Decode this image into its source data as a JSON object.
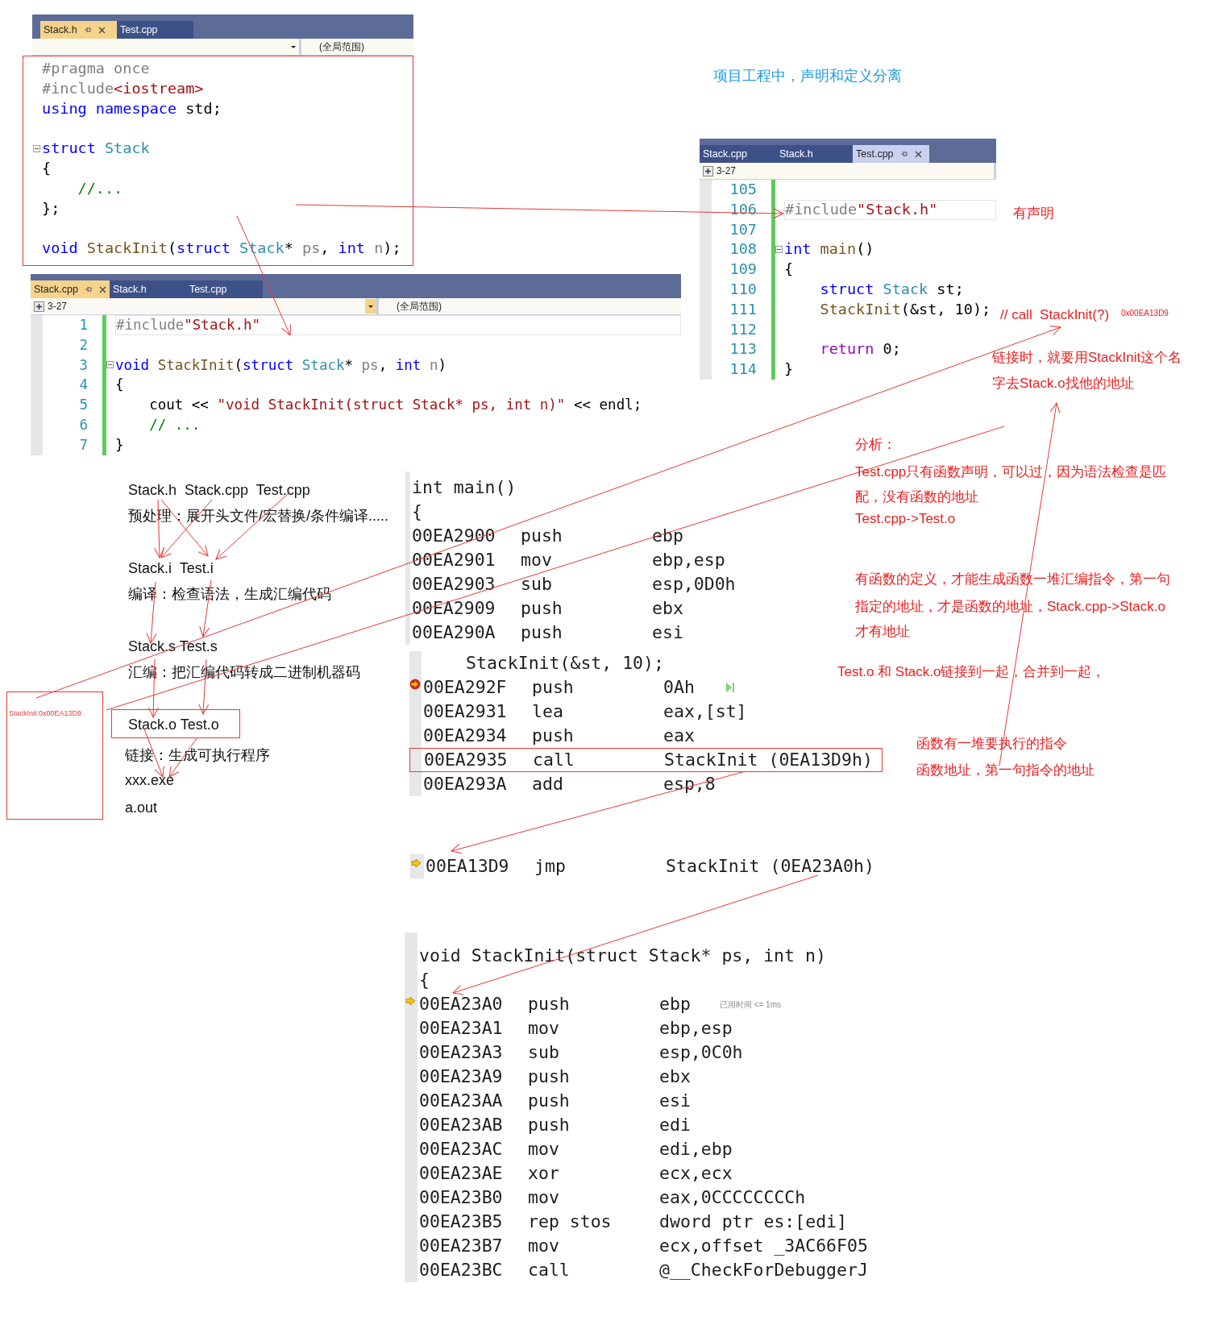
{
  "notes": [
    {
      "text": "项目工程中，声明和定义分离",
      "kind": "heading"
    },
    {
      "text": "有声明",
      "kind": "note"
    },
    {
      "text": "// call  StackInit(?)",
      "kind": "note"
    },
    {
      "text": "0x00EA13D9",
      "kind": "tiny"
    },
    {
      "text": "链接时，就要用StackInit这个名",
      "kind": "note"
    },
    {
      "text": "字去Stack.o找他的地址",
      "kind": "note"
    },
    {
      "text": "分析：",
      "kind": "note"
    },
    {
      "text": "Test.cpp只有函数声明，可以过，因为语法检查是匹",
      "kind": "note"
    },
    {
      "text": "配，没有函数的地址",
      "kind": "note"
    },
    {
      "text": "Test.cpp->Test.o",
      "kind": "note"
    },
    {
      "text": "有函数的定义，才能生成函数一堆汇编指令，第一句",
      "kind": "note"
    },
    {
      "text": "指定的地址，才是函数的地址，Stack.cpp->Stack.o",
      "kind": "note"
    },
    {
      "text": "才有地址",
      "kind": "note"
    },
    {
      "text": "Test.o 和 Stack.o链接到一起，合并到一起，",
      "kind": "note"
    },
    {
      "text": "函数有一堆要执行的指令",
      "kind": "note"
    },
    {
      "text": "函数地址，第一句指令的地址",
      "kind": "note"
    }
  ],
  "editors": [
    {
      "focused": true,
      "outlined": true,
      "tabs": [
        {
          "label": "Stack.h",
          "selected": true
        },
        {
          "label": "Test.cpp",
          "selected": false
        }
      ],
      "toolbar": {
        "scope": "(全局范围)"
      },
      "lines": [
        {
          "fold": false,
          "tokens": [
            {
              "text": "#pragma once",
              "kind": "pre"
            }
          ]
        },
        {
          "fold": false,
          "tokens": [
            {
              "text": "#include",
              "kind": "pre"
            },
            {
              "text": "<iostream>",
              "kind": "str"
            }
          ]
        },
        {
          "fold": false,
          "tokens": [
            {
              "text": "using namespace",
              "kind": "kw"
            },
            {
              "text": " std;",
              "kind": "plain"
            }
          ]
        },
        {
          "fold": false
        },
        {
          "fold": true,
          "tokens": [
            {
              "text": "struct",
              "kind": "kw"
            },
            {
              "text": " Stack",
              "kind": "type"
            }
          ]
        },
        {
          "fold": false,
          "tokens": [
            {
              "text": "{",
              "kind": "plain"
            }
          ]
        },
        {
          "fold": false,
          "tokens": [
            {
              "text": "    //...",
              "kind": "com"
            }
          ]
        },
        {
          "fold": false,
          "tokens": [
            {
              "text": "};",
              "kind": "plain"
            }
          ]
        },
        {
          "fold": false
        },
        {
          "fold": false,
          "tokens": [
            {
              "text": "void",
              "kind": "kw"
            },
            {
              "text": " StackInit",
              "kind": "func"
            },
            {
              "text": "(",
              "kind": "plain"
            },
            {
              "text": "struct",
              "kind": "kw"
            },
            {
              "text": " Stack",
              "kind": "type"
            },
            {
              "text": "* ",
              "kind": "plain"
            },
            {
              "text": "ps",
              "kind": "param"
            },
            {
              "text": ", ",
              "kind": "plain"
            },
            {
              "text": "int",
              "kind": "kw"
            },
            {
              "text": " n",
              "kind": "param"
            },
            {
              "text": ");",
              "kind": "plain"
            }
          ]
        }
      ]
    },
    {
      "focused": true,
      "outlined": false,
      "tabs": [
        {
          "label": "Stack.cpp",
          "selected": true
        },
        {
          "label": "Stack.h",
          "selected": false
        },
        {
          "label": "Test.cpp",
          "selected": false
        }
      ],
      "toolbar": {
        "project": "3-27",
        "scope": "(全局范围)"
      },
      "lines": [
        {
          "number": "1",
          "fold": false,
          "current": true,
          "tokens": [
            {
              "text": "#include",
              "kind": "pre"
            },
            {
              "text": "\"Stack.h\"",
              "kind": "str"
            }
          ]
        },
        {
          "number": "2",
          "fold": false,
          "current": false
        },
        {
          "number": "3",
          "fold": true,
          "current": false,
          "tokens": [
            {
              "text": "void",
              "kind": "kw"
            },
            {
              "text": " StackInit",
              "kind": "func"
            },
            {
              "text": "(",
              "kind": "plain"
            },
            {
              "text": "struct",
              "kind": "kw"
            },
            {
              "text": " Stack",
              "kind": "type"
            },
            {
              "text": "* ",
              "kind": "plain"
            },
            {
              "text": "ps",
              "kind": "param"
            },
            {
              "text": ", ",
              "kind": "plain"
            },
            {
              "text": "int",
              "kind": "kw"
            },
            {
              "text": " n",
              "kind": "param"
            },
            {
              "text": ")",
              "kind": "plain"
            }
          ]
        },
        {
          "number": "4",
          "fold": false,
          "current": false,
          "tokens": [
            {
              "text": "{",
              "kind": "plain"
            }
          ]
        },
        {
          "number": "5",
          "fold": false,
          "current": false,
          "tokens": [
            {
              "text": "    cout << ",
              "kind": "plain"
            },
            {
              "text": "\"void StackInit(struct Stack* ps, int n)\"",
              "kind": "str"
            },
            {
              "text": " << endl;",
              "kind": "plain"
            }
          ]
        },
        {
          "number": "6",
          "fold": false,
          "current": false,
          "tokens": [
            {
              "text": "    // ...",
              "kind": "com"
            }
          ]
        },
        {
          "number": "7",
          "fold": false,
          "current": false,
          "tokens": [
            {
              "text": "}",
              "kind": "plain"
            }
          ]
        }
      ]
    },
    {
      "focused": false,
      "outlined": false,
      "tabs": [
        {
          "label": "Stack.cpp",
          "selected": false
        },
        {
          "label": "Stack.h",
          "selected": false
        },
        {
          "label": "Test.cpp",
          "selected": true
        }
      ],
      "toolbar": {
        "project": "3-27"
      },
      "lines": [
        {
          "number": "105",
          "fold": false,
          "current": false
        },
        {
          "number": "106",
          "fold": false,
          "current": true,
          "tokens": [
            {
              "text": "#include",
              "kind": "pre"
            },
            {
              "text": "\"Stack.h\"",
              "kind": "str"
            }
          ]
        },
        {
          "number": "107",
          "fold": false,
          "current": false
        },
        {
          "number": "108",
          "fold": true,
          "current": false,
          "tokens": [
            {
              "text": "int",
              "kind": "kw"
            },
            {
              "text": " main",
              "kind": "func"
            },
            {
              "text": "()",
              "kind": "plain"
            }
          ]
        },
        {
          "number": "109",
          "fold": false,
          "current": false,
          "tokens": [
            {
              "text": "{",
              "kind": "plain"
            }
          ]
        },
        {
          "number": "110",
          "fold": false,
          "current": false,
          "tokens": [
            {
              "text": "    struct",
              "kind": "kw"
            },
            {
              "text": " Stack",
              "kind": "type"
            },
            {
              "text": " st;",
              "kind": "plain"
            }
          ]
        },
        {
          "number": "111",
          "fold": false,
          "current": false,
          "tokens": [
            {
              "text": "    StackInit",
              "kind": "func"
            },
            {
              "text": "(&st, 10);",
              "kind": "plain"
            }
          ]
        },
        {
          "number": "112",
          "fold": false,
          "current": false
        },
        {
          "number": "113",
          "fold": false,
          "current": false,
          "tokens": [
            {
              "text": "    return",
              "kind": "ctl"
            },
            {
              "text": " 0;",
              "kind": "plain"
            }
          ]
        },
        {
          "number": "114",
          "fold": false,
          "current": false,
          "tokens": [
            {
              "text": "}",
              "kind": "plain"
            }
          ]
        }
      ]
    }
  ],
  "build_steps": [
    {
      "text": "Stack.h  Stack.cpp  Test.cpp",
      "boxed": false
    },
    {
      "text": "预处理：展开头文件/宏替换/条件编译.....",
      "boxed": false
    },
    {
      "text": "Stack.i  Test.i",
      "boxed": false
    },
    {
      "text": "编译：检查语法，生成汇编代码",
      "boxed": false
    },
    {
      "text": "Stack.s Test.s",
      "boxed": false
    },
    {
      "text": "汇编：把汇编代码转成二进制机器码",
      "boxed": false
    },
    {
      "text": "Stack.o Test.o",
      "boxed": true
    },
    {
      "text": "链接：生成可执行程序",
      "boxed": false
    },
    {
      "text": "xxx.exe",
      "boxed": false
    },
    {
      "text": "a.out",
      "boxed": false
    }
  ],
  "address_note": "StackInit:0x00EA13D9",
  "disassembly": [
    {
      "header": [
        "int main()",
        "{"
      ],
      "rows": [
        {
          "address": "00EA2900",
          "mnemonic": "push",
          "operand": "ebp",
          "breakpoint": false,
          "current": false,
          "boxed": false
        },
        {
          "address": "00EA2901",
          "mnemonic": "mov",
          "operand": "ebp,esp",
          "breakpoint": false,
          "current": false,
          "boxed": false
        },
        {
          "address": "00EA2903",
          "mnemonic": "sub",
          "operand": "esp,0D0h",
          "breakpoint": false,
          "current": false,
          "boxed": false
        },
        {
          "address": "00EA2909",
          "mnemonic": "push",
          "operand": "ebx",
          "breakpoint": false,
          "current": false,
          "boxed": false
        },
        {
          "address": "00EA290A",
          "mnemonic": "push",
          "operand": "esi",
          "breakpoint": false,
          "current": false,
          "boxed": false
        }
      ]
    },
    {
      "header": [
        "StackInit(&st, 10);"
      ],
      "rows": [
        {
          "address": "00EA292F",
          "mnemonic": "push",
          "operand": "0Ah",
          "breakpoint": true,
          "current": true,
          "boxed": false,
          "run_icon": true
        },
        {
          "address": "00EA2931",
          "mnemonic": "lea",
          "operand": "eax,[st]",
          "breakpoint": false,
          "current": false,
          "boxed": false,
          "run_icon": false
        },
        {
          "address": "00EA2934",
          "mnemonic": "push",
          "operand": "eax",
          "breakpoint": false,
          "current": false,
          "boxed": false,
          "run_icon": false
        },
        {
          "address": "00EA2935",
          "mnemonic": "call",
          "operand": "StackInit (0EA13D9h)",
          "breakpoint": false,
          "current": false,
          "boxed": true,
          "run_icon": false
        },
        {
          "address": "00EA293A",
          "mnemonic": "add",
          "operand": "esp,8",
          "breakpoint": false,
          "current": false,
          "boxed": false,
          "run_icon": false
        }
      ]
    },
    {
      "rows": [
        {
          "address": "00EA13D9",
          "mnemonic": "jmp",
          "operand": "StackInit (0EA23A0h)",
          "breakpoint": false,
          "current": true,
          "boxed": false
        }
      ]
    },
    {
      "header": [
        "void StackInit(struct Stack* ps, int n)",
        "{"
      ],
      "rows": [
        {
          "address": "00EA23A0",
          "mnemonic": "push",
          "operand": "ebp",
          "breakpoint": false,
          "current": true,
          "boxed": false,
          "note": "已用时间 <= 1ms"
        },
        {
          "address": "00EA23A1",
          "mnemonic": "mov",
          "operand": "ebp,esp",
          "breakpoint": false,
          "current": false,
          "boxed": false
        },
        {
          "address": "00EA23A3",
          "mnemonic": "sub",
          "operand": "esp,0C0h",
          "breakpoint": false,
          "current": false,
          "boxed": false
        },
        {
          "address": "00EA23A9",
          "mnemonic": "push",
          "operand": "ebx",
          "breakpoint": false,
          "current": false,
          "boxed": false
        },
        {
          "address": "00EA23AA",
          "mnemonic": "push",
          "operand": "esi",
          "breakpoint": false,
          "current": false,
          "boxed": false
        },
        {
          "address": "00EA23AB",
          "mnemonic": "push",
          "operand": "edi",
          "breakpoint": false,
          "current": false,
          "boxed": false
        },
        {
          "address": "00EA23AC",
          "mnemonic": "mov",
          "operand": "edi,ebp",
          "breakpoint": false,
          "current": false,
          "boxed": false
        },
        {
          "address": "00EA23AE",
          "mnemonic": "xor",
          "operand": "ecx,ecx",
          "breakpoint": false,
          "current": false,
          "boxed": false
        },
        {
          "address": "00EA23B0",
          "mnemonic": "mov",
          "operand": "eax,0CCCCCCCCh",
          "breakpoint": false,
          "current": false,
          "boxed": false
        },
        {
          "address": "00EA23B5",
          "mnemonic": "rep stos",
          "operand": "dword ptr es:[edi]",
          "breakpoint": false,
          "current": false,
          "boxed": false
        },
        {
          "address": "00EA23B7",
          "mnemonic": "mov",
          "operand": "ecx,offset _3AC66F05",
          "breakpoint": false,
          "current": false,
          "boxed": false
        },
        {
          "address": "00EA23BC",
          "mnemonic": "call",
          "operand": "@__CheckForDebuggerJ",
          "breakpoint": false,
          "current": false,
          "boxed": false
        }
      ]
    }
  ]
}
